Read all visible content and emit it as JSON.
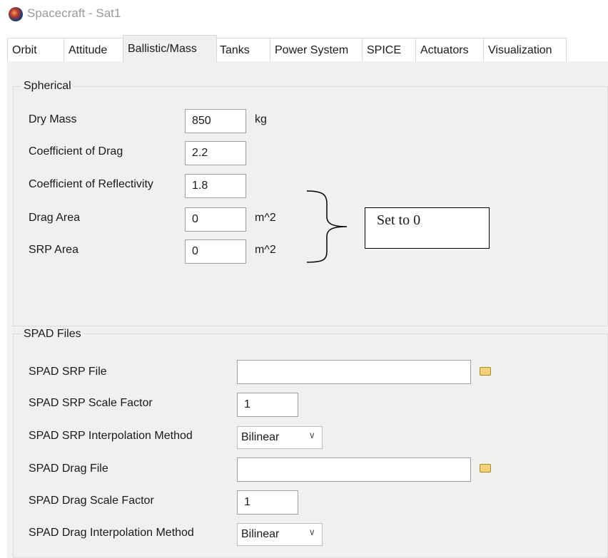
{
  "window": {
    "title": "Spacecraft - Sat1",
    "icon": "globe-icon"
  },
  "tabs": [
    {
      "label": "Orbit"
    },
    {
      "label": "Attitude"
    },
    {
      "label": "Ballistic/Mass",
      "active": true
    },
    {
      "label": "Tanks"
    },
    {
      "label": "Power System"
    },
    {
      "label": "SPICE"
    },
    {
      "label": "Actuators"
    },
    {
      "label": "Visualization"
    }
  ],
  "spherical": {
    "title": "Spherical",
    "dry_mass": {
      "label": "Dry Mass",
      "value": "850",
      "unit": "kg"
    },
    "cd": {
      "label": "Coefficient of Drag",
      "value": "2.2"
    },
    "cr": {
      "label": "Coefficient of Reflectivity",
      "value": "1.8"
    },
    "drag_area": {
      "label": "Drag Area",
      "value": "0",
      "unit": "m^2"
    },
    "srp_area": {
      "label": "SRP Area",
      "value": "0",
      "unit": "m^2"
    }
  },
  "annotation": {
    "text": "Set to 0"
  },
  "spad": {
    "title": "SPAD Files",
    "srp_file": {
      "label": "SPAD SRP File",
      "value": ""
    },
    "srp_scale": {
      "label": "SPAD SRP Scale Factor",
      "value": "1"
    },
    "srp_interp": {
      "label": "SPAD SRP Interpolation Method",
      "value": "Bilinear"
    },
    "drag_file": {
      "label": "SPAD Drag File",
      "value": ""
    },
    "drag_scale": {
      "label": "SPAD Drag Scale Factor",
      "value": "1"
    },
    "drag_interp": {
      "label": "SPAD Drag Interpolation Method",
      "value": "Bilinear"
    }
  },
  "colors": {
    "panel_bg": "#f0f0f0",
    "field_border": "#a0a0a0",
    "folder_icon": "#f1d27a"
  }
}
